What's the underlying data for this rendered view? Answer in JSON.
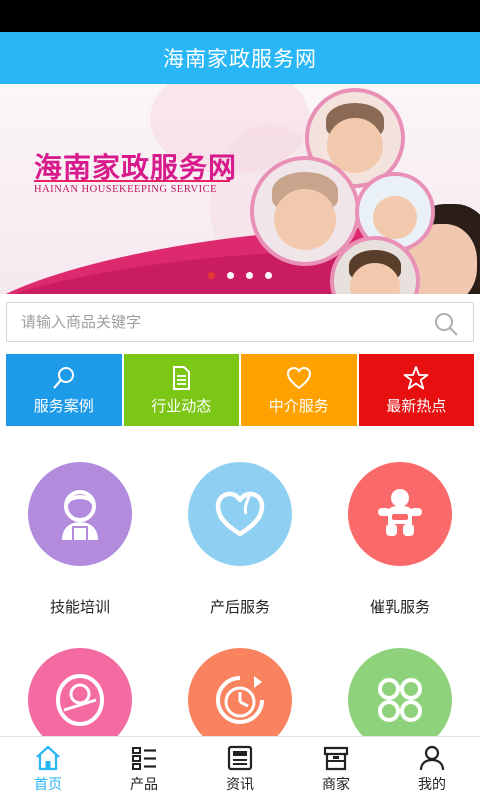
{
  "app": {
    "title": "海南家政服务网"
  },
  "banner": {
    "title": "海南家政服务网",
    "subtitle": "HAINAN HOUSEKEEPING SERVICE",
    "slide_count": 4,
    "active_slide": 1
  },
  "search": {
    "placeholder": "请输入商品关键字",
    "value": ""
  },
  "categories": [
    {
      "label": "服务案例",
      "icon": "search-icon",
      "color": "#1e9be8"
    },
    {
      "label": "行业动态",
      "icon": "document-icon",
      "color": "#7cc616"
    },
    {
      "label": "中介服务",
      "icon": "heart-icon",
      "color": "#ffa200"
    },
    {
      "label": "最新热点",
      "icon": "star-icon",
      "color": "#e61010"
    }
  ],
  "services": [
    {
      "label": "技能培训",
      "icon": "nanny-icon",
      "color": "#b28bdc"
    },
    {
      "label": "产后服务",
      "icon": "heart-icon",
      "color": "#8fd0f2"
    },
    {
      "label": "催乳服务",
      "icon": "baby-icon",
      "color": "#fb6a6a"
    },
    {
      "label": "",
      "icon": "swaddled-baby-icon",
      "color": "#f46ba2"
    },
    {
      "label": "",
      "icon": "clock-icon",
      "color": "#f8835e"
    },
    {
      "label": "",
      "icon": "clover-icon",
      "color": "#8fd27c"
    }
  ],
  "tabbar": [
    {
      "label": "首页",
      "icon": "home-icon",
      "active": true
    },
    {
      "label": "产品",
      "icon": "grid-list-icon",
      "active": false
    },
    {
      "label": "资讯",
      "icon": "news-icon",
      "active": false
    },
    {
      "label": "商家",
      "icon": "store-icon",
      "active": false
    },
    {
      "label": "我的",
      "icon": "user-icon",
      "active": false
    }
  ],
  "colors": {
    "accent": "#29b6f6",
    "banner_pink": "#d81b8c"
  }
}
